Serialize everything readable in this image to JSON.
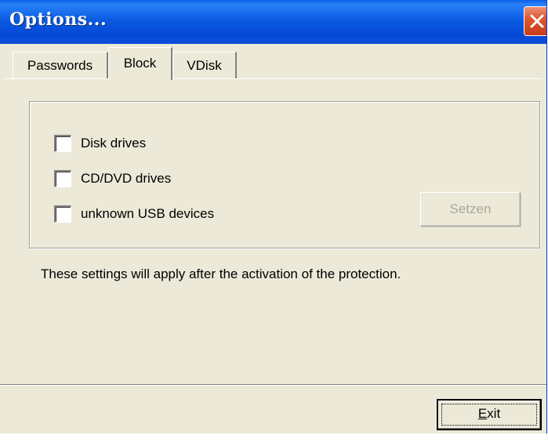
{
  "window": {
    "title": "Options...",
    "close_icon": "close-icon",
    "accent_color": "#0a5ee8",
    "close_color": "#e0582f"
  },
  "tabs": [
    {
      "label": "Passwords",
      "active": false
    },
    {
      "label": "Block",
      "active": true
    },
    {
      "label": "VDisk",
      "active": false
    }
  ],
  "block": {
    "options": [
      {
        "label": "Disk drives",
        "checked": false
      },
      {
        "label": "CD/DVD drives",
        "checked": false
      },
      {
        "label": "unknown USB devices",
        "checked": false
      }
    ],
    "set_button": {
      "label": "Setzen",
      "enabled": false
    },
    "info_text": "These settings will apply after the activation of the protection."
  },
  "footer": {
    "exit_button": {
      "label_first": "E",
      "label_rest": "xit"
    }
  }
}
